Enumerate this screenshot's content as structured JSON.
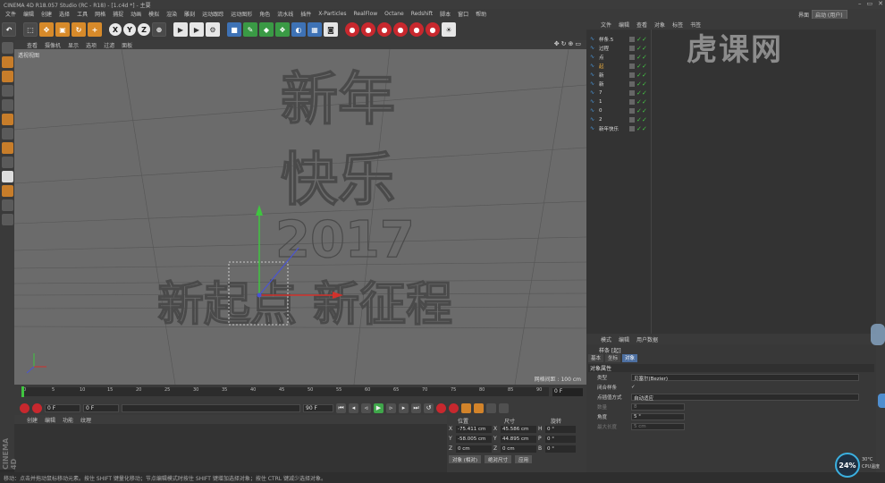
{
  "window": {
    "title": "CINEMA 4D R18.057 Studio (RC - R18) - [1.c4d *] - 主要"
  },
  "menubar": {
    "items": [
      "文件",
      "编辑",
      "创建",
      "选择",
      "工具",
      "网格",
      "捕捉",
      "动画",
      "模拟",
      "渲染",
      "雕刻",
      "运动跟踪",
      "运动图形",
      "角色",
      "流水线",
      "插件",
      "X-Particles",
      "RealFlow",
      "Octane",
      "Redshift",
      "脚本",
      "窗口",
      "帮助"
    ],
    "layout_label": "界面",
    "layout_value": "启动 (用户)"
  },
  "toolbar": {
    "axis_labels": [
      "X",
      "Y",
      "Z"
    ]
  },
  "viewport": {
    "menu": [
      "查看",
      "摄像机",
      "显示",
      "选项",
      "过滤",
      "面板"
    ],
    "label": "透视视图",
    "grid_info": "网格间距 : 100 cm",
    "text_lines": [
      "新年",
      "快乐",
      "2017",
      "新起点 新征程"
    ]
  },
  "timeline": {
    "ticks": [
      "0",
      "5",
      "10",
      "15",
      "20",
      "25",
      "30",
      "35",
      "40",
      "45",
      "50",
      "55",
      "60",
      "65",
      "70",
      "75",
      "80",
      "85",
      "90"
    ],
    "end_frame": "0 F"
  },
  "transport": {
    "current_frame": "0 F",
    "min_frame": "0 F",
    "max_frame": "90 F",
    "end_frame": "90 F"
  },
  "materials": {
    "menu": [
      "创建",
      "编辑",
      "功能",
      "纹理"
    ],
    "logo": "CINEMA 4D"
  },
  "coordinates": {
    "headers": [
      "位置",
      "尺寸",
      "旋转"
    ],
    "rows": [
      {
        "axis": "X",
        "pos": "-75.411 cm",
        "size_axis": "X",
        "size": "45.586 cm",
        "rot_axis": "H",
        "rot": "0 °"
      },
      {
        "axis": "Y",
        "pos": "-58.005 cm",
        "size_axis": "Y",
        "size": "44.895 cm",
        "rot_axis": "P",
        "rot": "0 °"
      },
      {
        "axis": "Z",
        "pos": "0 cm",
        "size_axis": "Z",
        "size": "0 cm",
        "rot_axis": "B",
        "rot": "0 °"
      }
    ],
    "mode_btn": "对象 (相对)",
    "size_btn": "绝对尺寸",
    "apply_btn": "应用"
  },
  "status": {
    "text": "移动：点击并拖动鼠标移动元素。按住 SHIFT 键量化移动；节点编辑模式时按住 SHIFT 键增加选择对象；按住 CTRL 键减少选择对象。"
  },
  "object_manager": {
    "menu": [
      "文件",
      "编辑",
      "查看",
      "对象",
      "标签",
      "书签"
    ],
    "objects": [
      "样条.5",
      "过程",
      "点",
      "起",
      "新",
      "新",
      "7",
      "1",
      "0",
      "2",
      "新年快乐"
    ]
  },
  "watermark": {
    "text": "虎课网"
  },
  "attributes": {
    "menu": [
      "模式",
      "编辑",
      "用户数据"
    ],
    "object_name": "样条 [起]",
    "tabs": [
      "基本",
      "坐标",
      "对象"
    ],
    "active_tab": 2,
    "section": "对象属性",
    "props": [
      {
        "label": "类型",
        "value": "贝塞尔(Bezier)",
        "kind": "dropdown"
      },
      {
        "label": "闭合样条",
        "value": "✓",
        "kind": "check"
      },
      {
        "label": "点插值方式",
        "value": "自动适应",
        "kind": "dropdown"
      },
      {
        "label": "数量",
        "value": "8",
        "kind": "field",
        "dim": true
      },
      {
        "label": "角度",
        "value": "5 °",
        "kind": "field",
        "dim": false
      },
      {
        "label": "最大长度",
        "value": "5 cm",
        "kind": "field",
        "dim": true
      }
    ]
  },
  "cpu_widget": {
    "percent": "24%",
    "temp": "30°C",
    "label": "CPU温度"
  },
  "colors": {
    "accent": "#4d6fa0",
    "ok": "#45c445",
    "viewport_bg": "#6b6b6b"
  }
}
